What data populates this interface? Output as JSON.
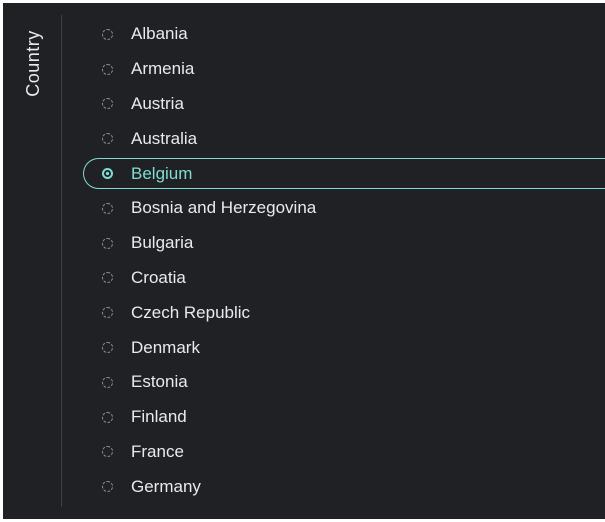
{
  "sidebar": {
    "title": "Country"
  },
  "countries": [
    {
      "label": "Albania",
      "selected": false
    },
    {
      "label": "Armenia",
      "selected": false
    },
    {
      "label": "Austria",
      "selected": false
    },
    {
      "label": "Australia",
      "selected": false
    },
    {
      "label": "Belgium",
      "selected": true
    },
    {
      "label": "Bosnia and Herzegovina",
      "selected": false
    },
    {
      "label": "Bulgaria",
      "selected": false
    },
    {
      "label": "Croatia",
      "selected": false
    },
    {
      "label": "Czech Republic",
      "selected": false
    },
    {
      "label": "Denmark",
      "selected": false
    },
    {
      "label": "Estonia",
      "selected": false
    },
    {
      "label": "Finland",
      "selected": false
    },
    {
      "label": "France",
      "selected": false
    },
    {
      "label": "Germany",
      "selected": false
    }
  ],
  "colors": {
    "background": "#202124",
    "text": "#e8eaed",
    "accent": "#7fdcd3",
    "radio": "#8a8e93"
  }
}
